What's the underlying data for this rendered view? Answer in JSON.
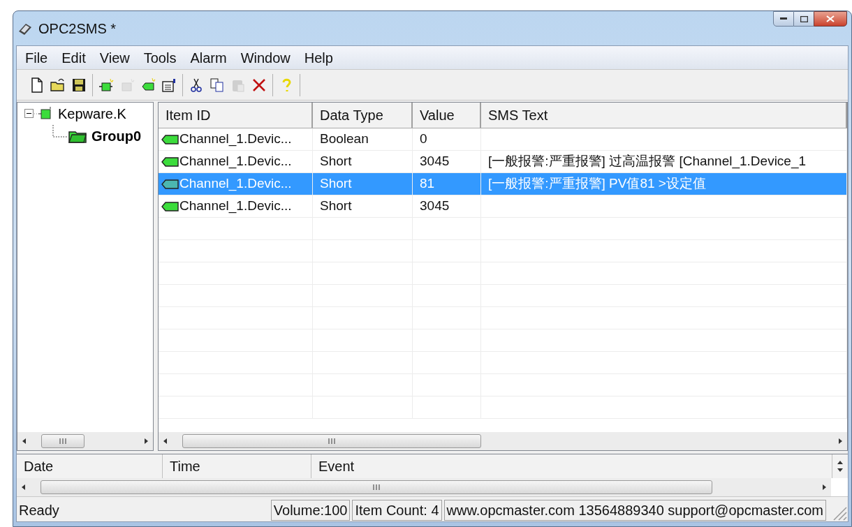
{
  "window": {
    "title": "OPC2SMS *"
  },
  "menu": [
    "File",
    "Edit",
    "View",
    "Tools",
    "Alarm",
    "Window",
    "Help"
  ],
  "toolbar": [
    [
      {
        "disabled": false
      },
      {
        "disabled": false
      },
      {
        "disabled": false
      }
    ],
    [
      {
        "disabled": false
      },
      {
        "disabled": true
      },
      {
        "disabled": false
      },
      {
        "disabled": false
      }
    ],
    [
      {
        "disabled": false
      },
      {
        "disabled": false
      },
      {
        "disabled": true
      },
      {
        "disabled": false
      }
    ],
    [
      {
        "disabled": false
      }
    ]
  ],
  "tree": [
    {
      "label": "Kepware.K",
      "expanded": true,
      "selected": false,
      "children": [
        {
          "label": "Group0",
          "selected": true
        }
      ]
    }
  ],
  "table": {
    "columns": [
      "Item ID",
      "Data Type",
      "Value",
      "SMS Text"
    ],
    "rows": [
      {
        "cells": [
          "Channel_1.Devic...",
          "Boolean",
          "0",
          ""
        ],
        "selected": false
      },
      {
        "cells": [
          "Channel_1.Devic...",
          "Short",
          "3045",
          "[一般报警:严重报警] 过高温报警 [Channel_1.Device_1"
        ],
        "selected": false
      },
      {
        "cells": [
          "Channel_1.Devic...",
          "Short",
          "81",
          "[一般报警:严重报警] PV值81 >设定值"
        ],
        "selected": true
      },
      {
        "cells": [
          "Channel_1.Devic...",
          "Short",
          "3045",
          ""
        ],
        "selected": false
      }
    ]
  },
  "log": {
    "columns": [
      "Date",
      "Time",
      "Event"
    ]
  },
  "status_bar": [
    "Ready",
    "Volume:100",
    "Item Count: 4",
    "www.opcmaster.com 13564889340 support@opcmaster.com"
  ]
}
